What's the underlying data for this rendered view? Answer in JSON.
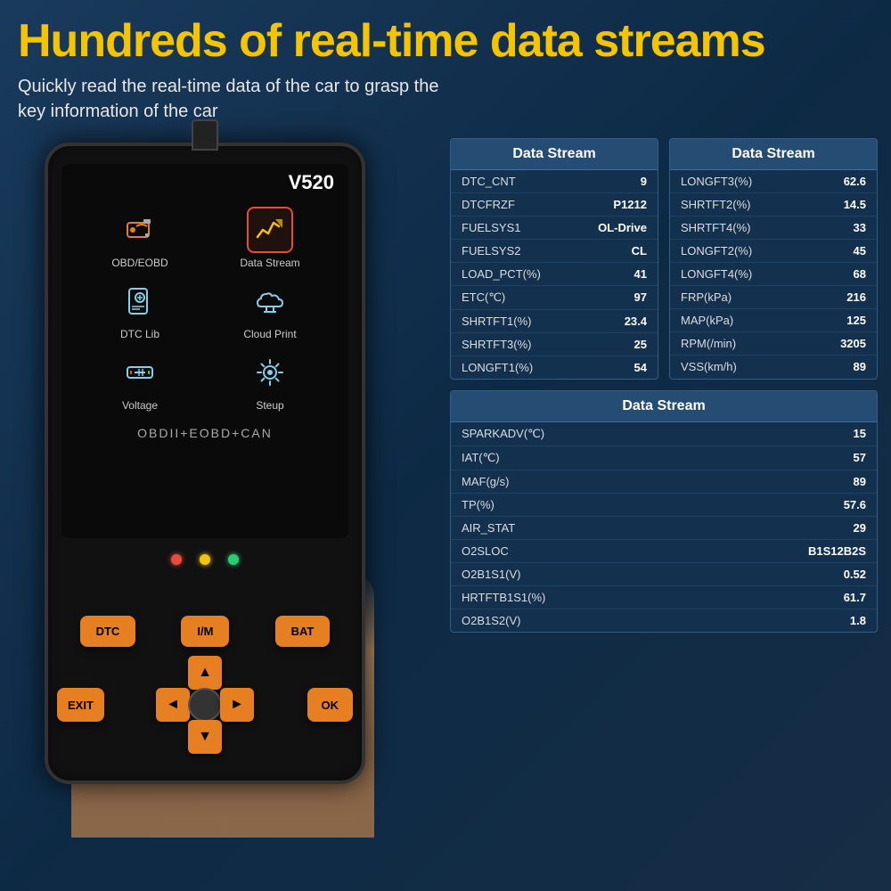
{
  "header": {
    "title": "Hundreds of real-time data streams",
    "subtitle": "Quickly read the real-time data of the car to grasp the\nkey information of the car"
  },
  "device": {
    "model": "V520",
    "obdii_label": "OBDII+EOBD+CAN",
    "menu_items": [
      {
        "id": "obd",
        "label": "OBD/EOBD",
        "highlighted": false
      },
      {
        "id": "data_stream",
        "label": "Data Stream",
        "highlighted": true
      },
      {
        "id": "dtc_lib",
        "label": "DTC Lib",
        "highlighted": false
      },
      {
        "id": "cloud_print",
        "label": "Cloud Print",
        "highlighted": false
      },
      {
        "id": "voltage",
        "label": "Voltage",
        "highlighted": false
      },
      {
        "id": "steup",
        "label": "Steup",
        "highlighted": false
      }
    ],
    "buttons": {
      "top_row": [
        "DTC",
        "I/M",
        "BAT"
      ],
      "nav": [
        "▲",
        "◄",
        "►",
        "▼"
      ],
      "side_labels": [
        "EXIT",
        "OK"
      ]
    },
    "leds": [
      {
        "color": "#e74c3c"
      },
      {
        "color": "#f1c40f"
      },
      {
        "color": "#2ecc71"
      }
    ]
  },
  "data_tables": {
    "table1": {
      "title": "Data Stream",
      "rows": [
        {
          "name": "DTC_CNT",
          "value": "9"
        },
        {
          "name": "DTCFRZF",
          "value": "P1212"
        },
        {
          "name": "FUELSYS1",
          "value": "OL-Drive"
        },
        {
          "name": "FUELSYS2",
          "value": "CL"
        },
        {
          "name": "LOAD_PCT(%)",
          "value": "41"
        },
        {
          "name": "ETC(℃)",
          "value": "97"
        },
        {
          "name": "SHRTFT1(%)",
          "value": "23.4"
        },
        {
          "name": "SHRTFT3(%)",
          "value": "25"
        },
        {
          "name": "LONGFT1(%)",
          "value": "54"
        }
      ]
    },
    "table2": {
      "title": "Data Stream",
      "rows": [
        {
          "name": "LONGFT3(%)",
          "value": "62.6"
        },
        {
          "name": "SHRTFT2(%)",
          "value": "14.5"
        },
        {
          "name": "SHRTFT4(%)",
          "value": "33"
        },
        {
          "name": "LONGFT2(%)",
          "value": "45"
        },
        {
          "name": "LONGFT4(%)",
          "value": "68"
        },
        {
          "name": "FRP(kPa)",
          "value": "216"
        },
        {
          "name": "MAP(kPa)",
          "value": "125"
        },
        {
          "name": "RPM(/min)",
          "value": "3205"
        },
        {
          "name": "VSS(km/h)",
          "value": "89"
        }
      ]
    },
    "table3": {
      "title": "Data Stream",
      "rows": [
        {
          "name": "SPARKADV(℃)",
          "value": "15"
        },
        {
          "name": "IAT(℃)",
          "value": "57"
        },
        {
          "name": "MAF(g/s)",
          "value": "89"
        },
        {
          "name": "TP(%)",
          "value": "57.6"
        },
        {
          "name": "AIR_STAT",
          "value": "29"
        },
        {
          "name": "O2SLOC",
          "value": "B1S12B2S"
        },
        {
          "name": "O2B1S1(V)",
          "value": "0.52"
        },
        {
          "name": "HRTFTB1S1(%)",
          "value": "61.7"
        },
        {
          "name": "O2B1S2(V)",
          "value": "1.8"
        }
      ]
    }
  },
  "colors": {
    "background": "#1a3a5c",
    "title_yellow": "#f5c400",
    "orange_btn": "#e67e22",
    "table_bg": "#0f3050",
    "table_header_bg": "#1a4a70"
  }
}
